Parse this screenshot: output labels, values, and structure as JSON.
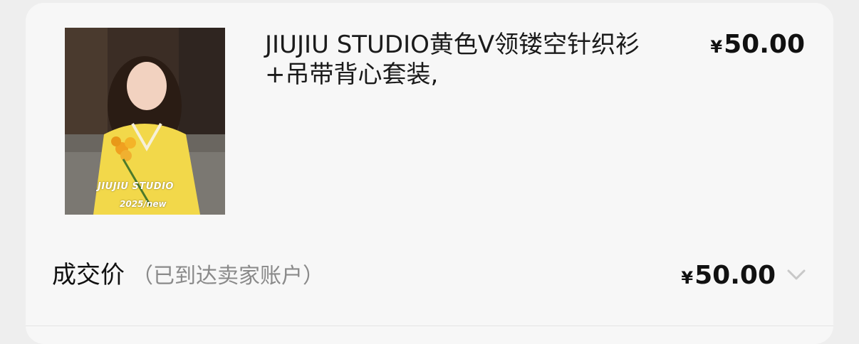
{
  "product": {
    "image_caption_brand": "JIUJIU STUDIO",
    "image_caption_tag": "2025/new",
    "title": "JIUJIU STUDIO黄色V领镂空针织衫+吊带背心套装,",
    "price_symbol": "¥",
    "price": "50.00"
  },
  "deal": {
    "label": "成交价",
    "note": "（已到达卖家账户）",
    "price_symbol": "¥",
    "price": "50.00",
    "expand_icon": "chevron-down-icon"
  },
  "colors": {
    "page_bg": "#eeeeee",
    "card_bg": "#f7f7f7",
    "text_primary": "#111111",
    "text_secondary": "#8a8a8a"
  }
}
